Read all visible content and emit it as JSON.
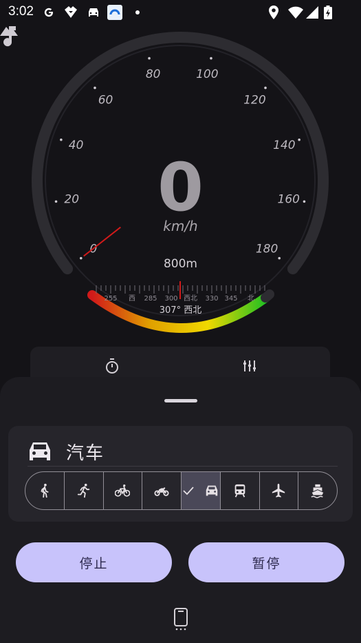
{
  "status_bar": {
    "time": "3:02",
    "left_icons": [
      "google-g-icon",
      "drive-icon",
      "car-icon",
      "app-icon",
      "dot-icon"
    ],
    "right_icons": [
      "location-icon",
      "wifi-icon",
      "signal-icon",
      "battery-charging-icon"
    ]
  },
  "gauge": {
    "speed": "0",
    "unit": "km/h",
    "altitude": "800m",
    "heading": "307° 西北",
    "max_speed": 180,
    "speed_labels": [
      {
        "value": 0,
        "label": "0"
      },
      {
        "value": 20,
        "label": "20"
      },
      {
        "value": 40,
        "label": "40"
      },
      {
        "value": 60,
        "label": "60"
      },
      {
        "value": 80,
        "label": "80"
      },
      {
        "value": 100,
        "label": "100"
      },
      {
        "value": 120,
        "label": "120"
      },
      {
        "value": 140,
        "label": "140"
      },
      {
        "value": 160,
        "label": "160"
      },
      {
        "value": 180,
        "label": "180"
      }
    ],
    "compass_labels": [
      "255",
      "西",
      "285",
      "300",
      "西北",
      "330",
      "345",
      "北"
    ],
    "compass_heading_degrees": 307
  },
  "tool_panel": {
    "icons": [
      "stopwatch-icon",
      "equalizer-icon"
    ]
  },
  "sheet": {
    "selected_mode_label": "汽车",
    "modes": [
      {
        "name": "walk",
        "icon": "walk-icon"
      },
      {
        "name": "run",
        "icon": "run-icon"
      },
      {
        "name": "bicycle",
        "icon": "bicycle-icon"
      },
      {
        "name": "motorcycle",
        "icon": "motorcycle-icon"
      },
      {
        "name": "car",
        "icon": "car-icon",
        "selected": true
      },
      {
        "name": "train",
        "icon": "train-icon"
      },
      {
        "name": "airplane",
        "icon": "airplane-icon"
      },
      {
        "name": "boat",
        "icon": "boat-icon"
      }
    ],
    "stop_label": "停止",
    "pause_label": "暂停"
  },
  "colors": {
    "accent_button": "#c8c3fb",
    "button_text": "#2e2a4e",
    "needle": "#d11a1a",
    "gauge_gradient": [
      "#d11a1a",
      "#e0a000",
      "#f0d800",
      "#22c022"
    ]
  }
}
